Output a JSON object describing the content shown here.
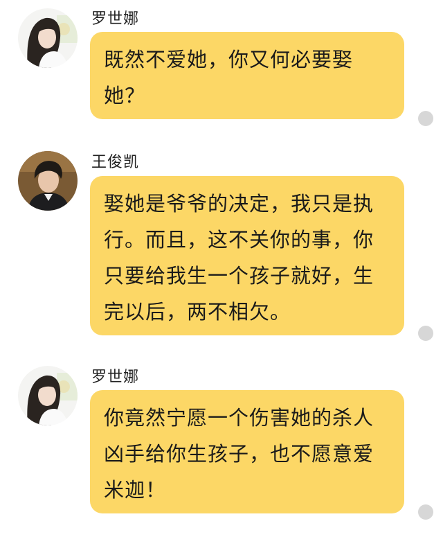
{
  "messages": [
    {
      "sender": "罗世娜",
      "avatar_icon": "female-avatar-icon",
      "text": "既然不爱她，你又何必要娶她？"
    },
    {
      "sender": "王俊凯",
      "avatar_icon": "male-avatar-icon",
      "text": "娶她是爷爷的决定，我只是执行。而且，这不关你的事，你只要给我生一个孩子就好，生完以后，两不相欠。"
    },
    {
      "sender": "罗世娜",
      "avatar_icon": "female-avatar-icon",
      "text": "你竟然宁愿一个伤害她的杀人凶手给你生孩子，也不愿意爱米迦！"
    }
  ],
  "colors": {
    "bubble": "#fcd766",
    "status_dot": "#d7d7d7"
  }
}
